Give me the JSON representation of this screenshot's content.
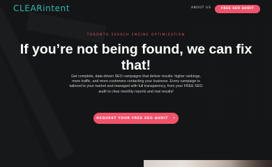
{
  "header": {
    "logo_part1": "CLEAR",
    "logo_part2": "intent",
    "nav_about": "ABOUT US",
    "nav_cta": "FREE SEO AUDIT"
  },
  "hero": {
    "eyebrow": "TORONTO SEARCH ENGINE OPTIMIZATION",
    "headline": "If you’re not being found, we can fix that!",
    "body": "Get complete, data-driven SEO campaigns that deliver results: higher rankings, more traffic, and more customers contacting your business. Every campaign is tailored to your market and managed with full transparency, from your FREE SEO audit to clear monthly reports and real results!",
    "cta_label": "REQUEST YOUR FREE SEO AUDIT",
    "cta_chevron": "›"
  },
  "colors": {
    "background": "#141516",
    "accent": "#f0536b",
    "brand": "#2fb9b1"
  },
  "icons": {
    "cta_icon": "chevron-right-icon",
    "background_mark": "brand-mark-icon"
  }
}
